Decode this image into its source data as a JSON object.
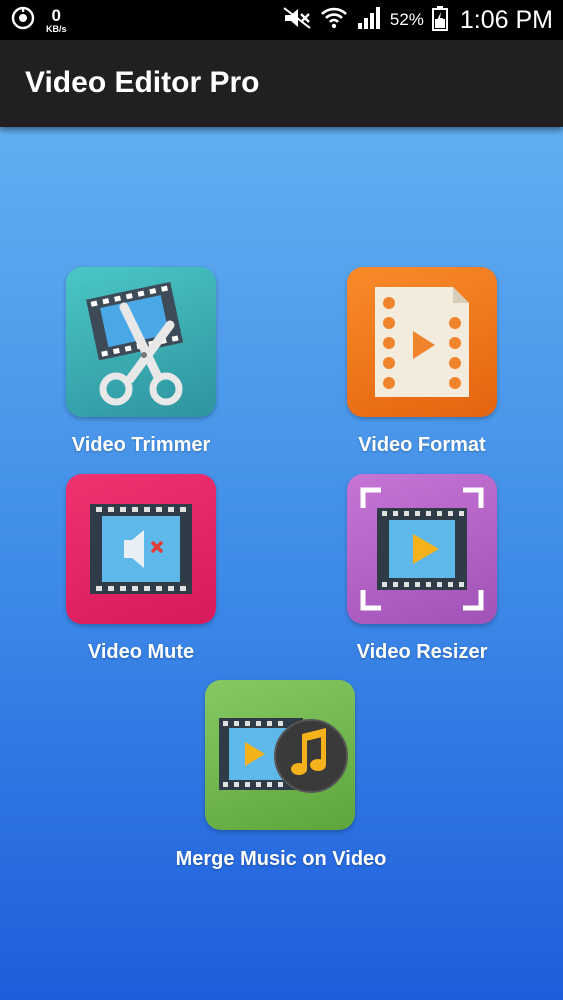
{
  "status_bar": {
    "speed_value": "0",
    "speed_unit": "KB/s",
    "battery_percent": "52%",
    "time": "1:06 PM",
    "icons": [
      "data-saver-icon",
      "mute-icon",
      "wifi-icon",
      "signal-icon",
      "battery-icon"
    ]
  },
  "app_bar": {
    "title": "Video Editor Pro"
  },
  "tools": [
    {
      "label": "Video Trimmer",
      "icon": "scissors-film-icon",
      "color": "#3fb2b5"
    },
    {
      "label": "Video Format",
      "icon": "film-document-icon",
      "color": "#f27a1c"
    },
    {
      "label": "Video Mute",
      "icon": "muted-film-icon",
      "color": "#e8276a"
    },
    {
      "label": "Video Resizer",
      "icon": "resize-film-icon",
      "color": "#b464c6"
    },
    {
      "label": "Merge Music on Video",
      "icon": "music-film-icon",
      "color": "#77bf54"
    }
  ]
}
